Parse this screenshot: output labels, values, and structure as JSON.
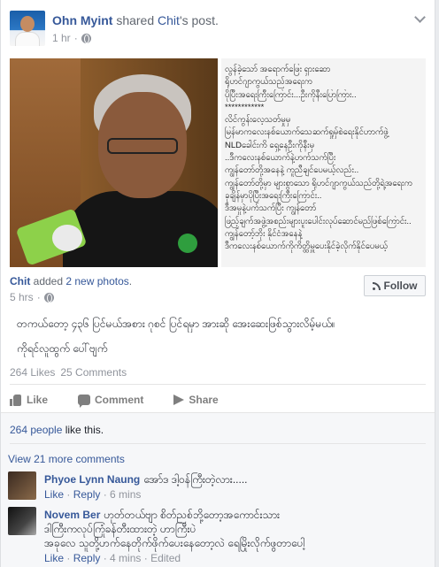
{
  "post": {
    "author": "Ohn Myint",
    "action_text": " shared ",
    "shared_owner": "Chit",
    "shared_suffix": "'s post.",
    "time": "1 hr",
    "icons": {
      "privacy": "globe-icon",
      "menu": "chevron-down-icon"
    }
  },
  "photo_text": [
    "လွန်ခဲ့သော် အရောက်ဖြေး ရှားဆော",
    "ရိုဟင်ဂျာကွယ်သည်အရေးက",
    "ပိုပြီးအရေးကြီးကြောင်း...ဦးကိုနီးပြောကြား..",
    "************",
    "လိင်ကွန်းလေ့သတ်မှုမှ",
    "မြန်မာကလေးနစ်ယောက်သေဆက်ရှုမှ်စဲရေးနိုင်ဟာက်ဖွဲ့",
    "NLDခေါင်းကိ ရှေ့နေဦးကိုနီးမှ",
    "..ဒီကလေးနစ်ယောက်နဲ့ဟက်သက်ပြီး",
    "ကျွန်တော်တို့အနေနဲ့ ကူညီချင်ပေမယ့်လည်း..",
    "ကျွန်တော်တို့မှာ များစွာသော ရိုဟင်ဂျာကွယ်သည်တို့ရဲ့အရေးက",
    "ခုချိန်မှာပိုပြီးအရေးကြီးကြောင်း..",
    "ဒီအမှုနဲ့ပက်သက်ပြီး ကျွန်တော်",
    "ဖြည့်ချက်အဖွဲ့အစည်းများပူးပေါင်းလုပ်ဆောင်မည်ဖြစ်ကြောင်း..",
    "ကျွန်တော့်ဘိုး နိုင်ငံအနေနဲ့",
    "ဒီကလေးနစ်ယောက်ကိုကိတ္ထိမှူပေးနိုင်ခဲ့လိုက်နိုင်ပေမယ့်"
  ],
  "shared": {
    "author": "Chit",
    "added_text": " added ",
    "new_photos": "2 new photos",
    "period": ".",
    "time": "5 hrs",
    "follow_label": "Follow",
    "status_line1": "တကယ်တော့ ၄၃၆ ပြင်မယ်အစား ဂုစင် ပြင်ရမှာ အားဆို အေးဆေးဖြစ်သွားလိမ့်မယ်။",
    "status_line2": "ကိုရင်လူထွက် ပေါ်ဗျက်"
  },
  "stats": {
    "likes": "264 Likes",
    "comments": "25 Comments"
  },
  "actions": {
    "like": "Like",
    "comment": "Comment",
    "share": "Share"
  },
  "feedback": {
    "people_like": "264 people",
    "people_like_suffix": " like this.",
    "view_more": "View 21 more comments"
  },
  "comments": [
    {
      "author": "Phyoe Lynn Naung",
      "text": "အော်ဒ ဒါ့ဝန်ကြီးတဲ့လား.....",
      "like": "Like",
      "reply": "Reply",
      "time": "6 mins"
    },
    {
      "author": "Novem Ber",
      "text_line1": "ဟုတ်တယ်ဗျာ စိတ်ညစ်ဘို့တော့အကောင်းသား",
      "text_line2": "ဒါကြီးကလုပ်ကြုံခန်တီးထားတဲ့ ဟာကြီးပဲ",
      "text_line3": "အခုလေ သူတို့ဟက်နေတိုက်ဖိုက်ပေးနေတော့လဲ ရေမြိုးလိုက်ဖွတာပေါ့",
      "like": "Like",
      "reply": "Reply",
      "time": "4 mins",
      "edited": "Edited"
    }
  ]
}
